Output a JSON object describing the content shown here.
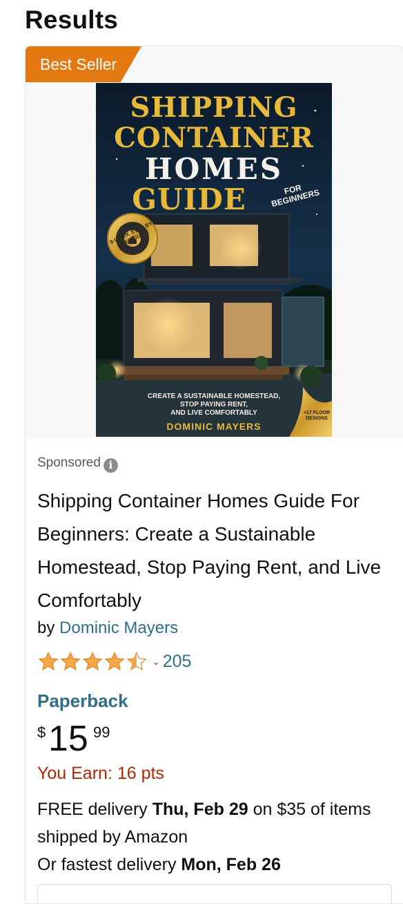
{
  "header": {
    "title": "Results"
  },
  "result": {
    "badge": "Best Seller",
    "cover": {
      "title_lines": [
        "SHIPPING",
        "CONTAINER",
        "HOMES",
        "GUIDE"
      ],
      "for_beginners": "FOR BEGINNERS",
      "seal_text": "9-WEEK STEP BY STEP GUIDE",
      "subtitle_lines": [
        "CREATE A SUSTAINABLE HOMESTEAD,",
        "STOP PAYING RENT,",
        "AND LIVE COMFORTABLY"
      ],
      "author": "DOMINIC MAYERS",
      "floor_designs": "+17 FLOOR DESIGNS"
    },
    "sponsored_label": "Sponsored",
    "title": "Shipping Container Homes Guide For Beginners: Create a Sustainable Homestead, Stop Paying Rent, and Live Comfortably",
    "by_label": "by",
    "author": "Dominic Mayers",
    "rating": {
      "stars": 4.5,
      "count": "205"
    },
    "format": "Paperback",
    "price": {
      "symbol": "$",
      "whole": "15",
      "fraction": "99"
    },
    "earn": "You Earn: 16 pts",
    "delivery": {
      "line1_prefix": "FREE delivery ",
      "line1_date": "Thu, Feb 29",
      "line1_suffix": " on $35 of items shipped by Amazon",
      "line2_prefix": "Or fastest delivery ",
      "line2_date": "Mon, Feb 26"
    },
    "colors": {
      "badge": "#e47911",
      "link": "#2f6f86",
      "earn": "#b12704",
      "star": "#f3a847"
    }
  }
}
